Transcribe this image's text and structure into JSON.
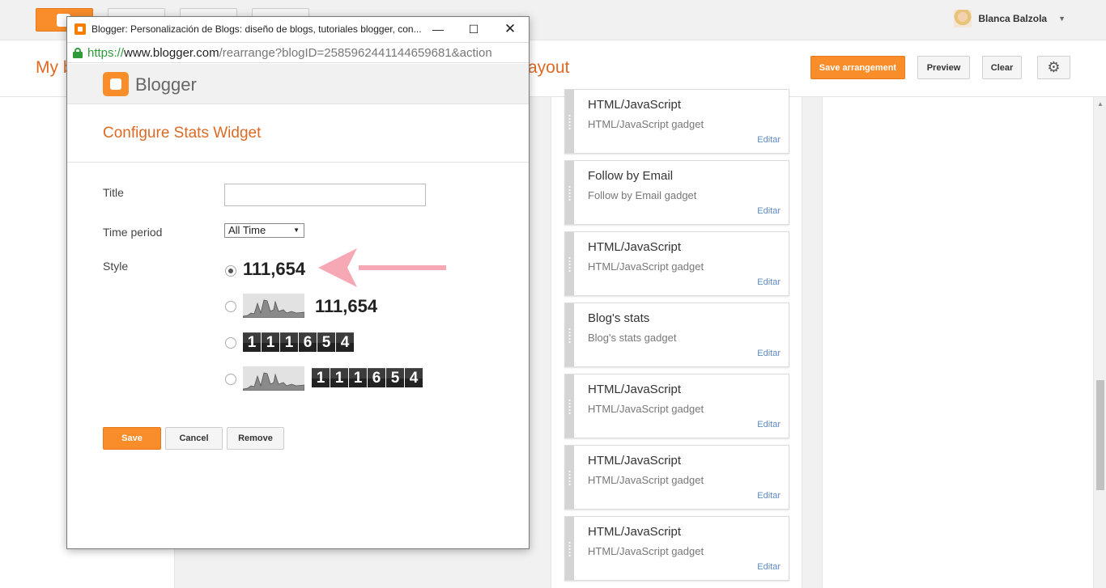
{
  "user": {
    "name": "Blanca Balzola"
  },
  "page": {
    "title_left": "My b",
    "title_right": "ayout"
  },
  "toolbar": {
    "save_arrangement": "Save arrangement",
    "preview": "Preview",
    "clear": "Clear"
  },
  "gadgets": [
    {
      "title": "HTML/JavaScript",
      "subtitle": "HTML/JavaScript gadget",
      "edit": "Editar"
    },
    {
      "title": "Follow by Email",
      "subtitle": "Follow by Email gadget",
      "edit": "Editar"
    },
    {
      "title": "HTML/JavaScript",
      "subtitle": "HTML/JavaScript gadget",
      "edit": "Editar"
    },
    {
      "title": "Blog's stats",
      "subtitle": "Blog's stats gadget",
      "edit": "Editar"
    },
    {
      "title": "HTML/JavaScript",
      "subtitle": "HTML/JavaScript gadget",
      "edit": "Editar"
    },
    {
      "title": "HTML/JavaScript",
      "subtitle": "HTML/JavaScript gadget",
      "edit": "Editar"
    },
    {
      "title": "HTML/JavaScript",
      "subtitle": "HTML/JavaScript gadget",
      "edit": "Editar"
    }
  ],
  "popup": {
    "window_title": "Blogger: Personalización de Blogs: diseño de blogs, tutoriales blogger, con...",
    "url": {
      "scheme": "https://",
      "host": "www.blogger.com",
      "path": "/rearrange?blogID=2585962441144659681&action"
    },
    "brand": "Blogger",
    "heading": "Configure Stats Widget",
    "labels": {
      "title": "Title",
      "time_period": "Time period",
      "style": "Style"
    },
    "title_value": "",
    "time_period": {
      "selected": "All Time"
    },
    "count": "111,654",
    "digits": [
      "1",
      "1",
      "1",
      "6",
      "5",
      "4"
    ],
    "selected_style": 0,
    "buttons": {
      "save": "Save",
      "cancel": "Cancel",
      "remove": "Remove"
    }
  },
  "colors": {
    "brand_orange": "#f98d2a",
    "heading_orange": "#dd6a24",
    "link_blue": "#5b8ac4",
    "annotation_pink": "#f6a9b4"
  }
}
